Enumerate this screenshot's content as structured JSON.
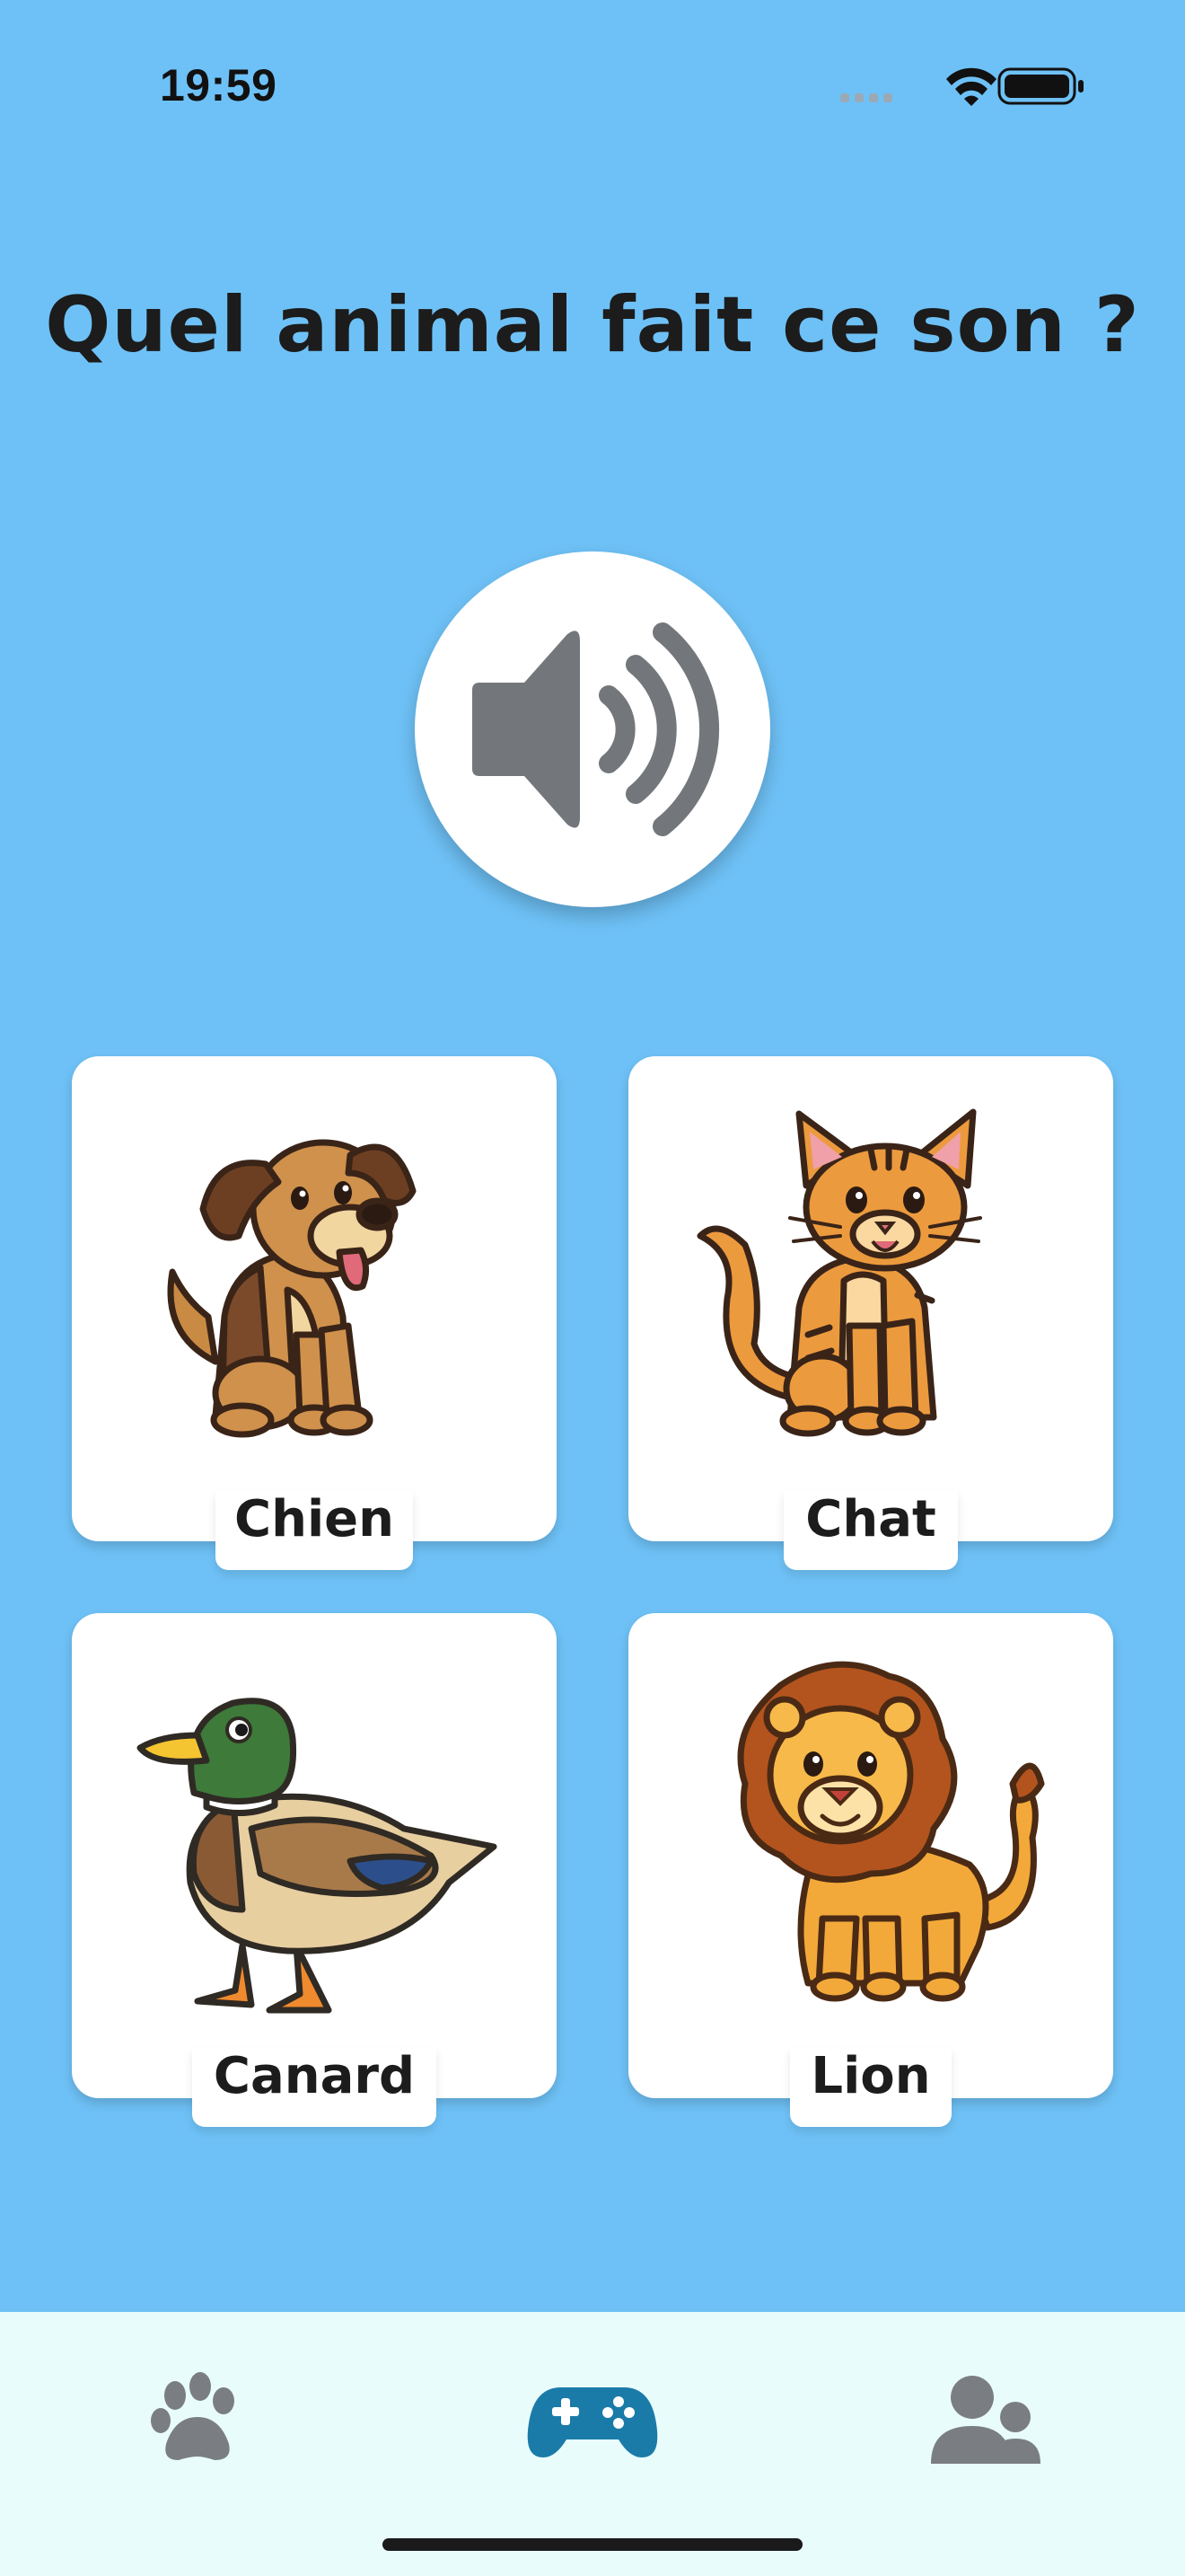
{
  "status_bar": {
    "time": "19:59"
  },
  "question": {
    "title": "Quel animal fait ce son ?"
  },
  "sound_button": {
    "icon": "speaker-wave-icon"
  },
  "choices": [
    {
      "label": "Chien",
      "icon": "dog-illustration"
    },
    {
      "label": "Chat",
      "icon": "cat-illustration"
    },
    {
      "label": "Canard",
      "icon": "duck-illustration"
    },
    {
      "label": "Lion",
      "icon": "lion-illustration"
    }
  ],
  "tab_bar": {
    "items": [
      {
        "icon": "paw-icon",
        "active": false
      },
      {
        "icon": "gamepad-icon",
        "active": true
      },
      {
        "icon": "users-icon",
        "active": false
      }
    ],
    "active_color": "#1a7ba8",
    "inactive_color": "#7a7e82"
  },
  "colors": {
    "background": "#6ec1f6",
    "card": "#ffffff",
    "tab_bar_background": "#e9fcfc"
  }
}
